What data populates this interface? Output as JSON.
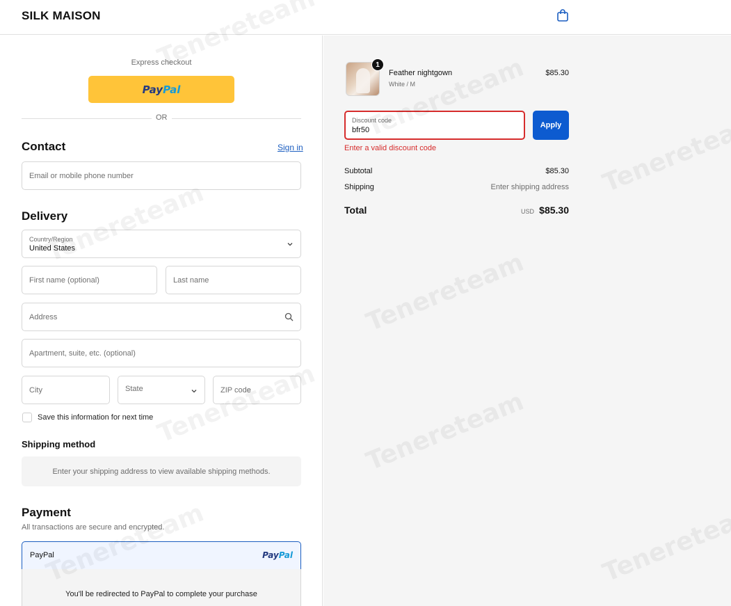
{
  "header": {
    "brand": "SILK MAISON",
    "cart_icon": "shopping-bag-icon"
  },
  "express": {
    "label": "Express checkout",
    "paypal_part1": "Pay",
    "paypal_part2": "Pal",
    "or": "OR"
  },
  "contact": {
    "title": "Contact",
    "sign_in": "Sign in",
    "email_placeholder": "Email or mobile phone number"
  },
  "delivery": {
    "title": "Delivery",
    "country_label": "Country/Region",
    "country_value": "United States",
    "first_name_placeholder": "First name (optional)",
    "last_name_placeholder": "Last name",
    "address_placeholder": "Address",
    "apartment_placeholder": "Apartment, suite, etc. (optional)",
    "city_placeholder": "City",
    "state_placeholder": "State",
    "zip_placeholder": "ZIP code",
    "save_info_label": "Save this information for next time"
  },
  "shipping_method": {
    "title": "Shipping method",
    "message": "Enter your shipping address to view available shipping methods."
  },
  "payment": {
    "title": "Payment",
    "subtitle": "All transactions are secure and encrypted.",
    "option_label": "PayPal",
    "logo_part1": "Pay",
    "logo_part2": "Pal",
    "redirect_text": "You'll be redirected to PayPal to complete your purchase"
  },
  "summary": {
    "item": {
      "name": "Feather nightgown",
      "variant": "White / M",
      "price": "$85.30",
      "quantity": "1"
    },
    "discount": {
      "label": "Discount code",
      "value": "bfr50",
      "apply": "Apply",
      "error": "Enter a valid discount code"
    },
    "subtotal_label": "Subtotal",
    "subtotal_value": "$85.30",
    "shipping_label": "Shipping",
    "shipping_value": "Enter shipping address",
    "total_label": "Total",
    "currency": "USD",
    "total_value": "$85.30"
  },
  "watermark": "Tenereteam",
  "colors": {
    "paypal_yellow": "#ffc439",
    "primary_blue": "#0d5bd0",
    "error_red": "#d62c2c",
    "summary_bg": "#f5f5f5"
  }
}
